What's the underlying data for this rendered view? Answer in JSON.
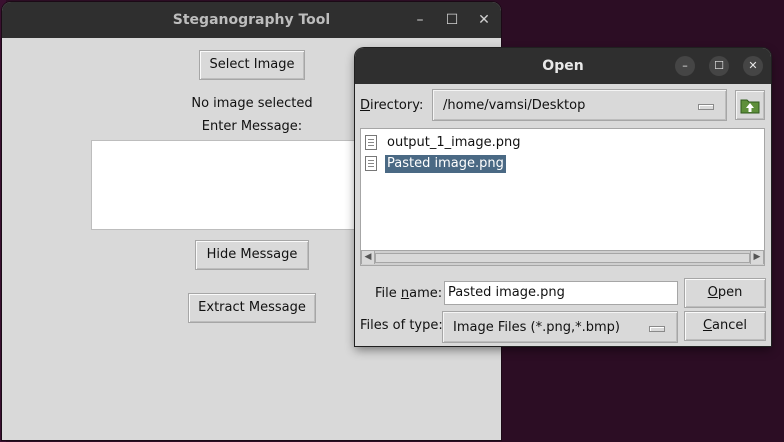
{
  "main_window": {
    "title": "Steganography Tool",
    "select_image_label": "Select Image",
    "status_text": "No image selected",
    "enter_message_label": "Enter Message:",
    "message_value": "",
    "hide_message_label": "Hide Message",
    "extract_message_label": "Extract Message"
  },
  "dialog": {
    "title": "Open",
    "directory": {
      "label_u": "D",
      "label_rest": "irectory:",
      "value": "/home/vamsi/Desktop"
    },
    "files": [
      {
        "name": "output_1_image.png",
        "selected": false
      },
      {
        "name": "Pasted image.png",
        "selected": true
      }
    ],
    "file_name": {
      "label_a": "File ",
      "label_u": "n",
      "label_b": "ame:",
      "value": "Pasted image.png"
    },
    "file_type": {
      "label": "Files of type:",
      "value": "Image Files (*.png,*.bmp)"
    },
    "open_label_u": "O",
    "open_label_rest": "pen",
    "cancel_label_u": "C",
    "cancel_label_rest": "ancel"
  },
  "icons": [
    "minimize-icon",
    "maximize-icon",
    "close-icon",
    "folder-up-icon",
    "file-icon"
  ],
  "colors": {
    "selection": "#4a6984",
    "titlebar": "#2f2f2f",
    "desktop": "#2c0d24"
  }
}
